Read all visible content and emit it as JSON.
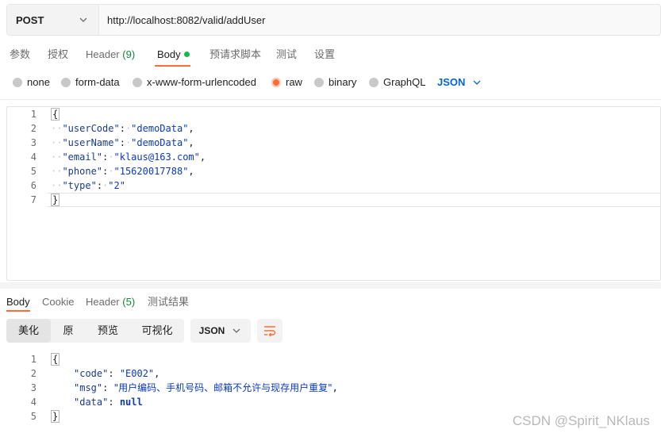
{
  "request": {
    "method": "POST",
    "url": "http://localhost:8082/valid/addUser"
  },
  "request_tabs": [
    {
      "label": "参数"
    },
    {
      "label": "授权"
    },
    {
      "label": "Header",
      "count": "(9)"
    },
    {
      "label": "Body"
    },
    {
      "label": "预请求脚本"
    },
    {
      "label": "测试"
    },
    {
      "label": "设置"
    }
  ],
  "body_types": [
    "none",
    "form-data",
    "x-www-form-urlencoded",
    "raw",
    "binary",
    "GraphQL"
  ],
  "body_type_selected": "raw",
  "body_format": "JSON",
  "request_body": {
    "line_numbers": [
      "1",
      "2",
      "3",
      "4",
      "5",
      "6",
      "7"
    ],
    "open_brace": "{",
    "close_brace": "}",
    "fields": [
      {
        "key": "\"userCode\"",
        "value": "\"demoData\"",
        "comma": ","
      },
      {
        "key": "\"userName\"",
        "value": "\"demoData\"",
        "comma": ","
      },
      {
        "key": "\"email\"",
        "value": "\"klaus@163.com\"",
        "comma": ","
      },
      {
        "key": "\"phone\"",
        "value": "\"15620017788\"",
        "comma": ","
      },
      {
        "key": "\"type\"",
        "value": "\"2\"",
        "comma": ""
      }
    ]
  },
  "response_tabs": [
    {
      "label": "Body"
    },
    {
      "label": "Cookie"
    },
    {
      "label": "Header",
      "count": "(5)"
    },
    {
      "label": "测试结果"
    }
  ],
  "response_views": [
    "美化",
    "原",
    "预览",
    "可视化"
  ],
  "response_format": "JSON",
  "response_body": {
    "line_numbers": [
      "1",
      "2",
      "3",
      "4",
      "5"
    ],
    "open_brace": "{",
    "close_brace": "}",
    "code_key": "\"code\"",
    "code_value": "\"E002\"",
    "msg_key": "\"msg\"",
    "msg_value": "\"用户编码、手机号码、邮箱不允许与现存用户重复\"",
    "data_key": "\"data\"",
    "data_value": "null"
  },
  "watermark": "CSDN @Spirit_NKlaus",
  "colors": {
    "accent": "#ff6c37",
    "link_blue": "#0265d2",
    "count_green": "#0b8a3a",
    "dot_green": "#0cbb52"
  }
}
